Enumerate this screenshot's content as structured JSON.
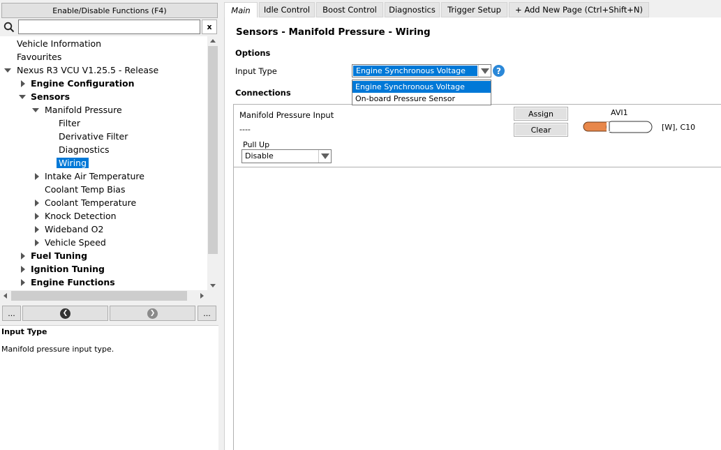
{
  "left_panel": {
    "enable_button_label": "Enable/Disable Functions (F4)",
    "search": {
      "value": "",
      "placeholder": ""
    },
    "clear_search_label": "x",
    "tree": [
      {
        "label": "Vehicle Information"
      },
      {
        "label": "Favourites"
      },
      {
        "label": "Nexus R3 VCU V1.25.5 - Release"
      },
      {
        "label": "Engine Configuration"
      },
      {
        "label": "Sensors"
      },
      {
        "label": "Manifold Pressure"
      },
      {
        "label": "Filter"
      },
      {
        "label": "Derivative Filter"
      },
      {
        "label": "Diagnostics"
      },
      {
        "label": "Wiring"
      },
      {
        "label": "Intake Air Temperature"
      },
      {
        "label": "Coolant Temp Bias"
      },
      {
        "label": "Coolant Temperature"
      },
      {
        "label": "Knock Detection"
      },
      {
        "label": "Wideband O2"
      },
      {
        "label": "Vehicle Speed"
      },
      {
        "label": "Fuel Tuning"
      },
      {
        "label": "Ignition Tuning"
      },
      {
        "label": "Engine Functions"
      }
    ],
    "nav": {
      "more_left": "...",
      "more_right": "..."
    },
    "help": {
      "title": "Input Type",
      "description": "Manifold pressure input type."
    }
  },
  "tabs": [
    {
      "label": "Main"
    },
    {
      "label": "Idle Control"
    },
    {
      "label": "Boost Control"
    },
    {
      "label": "Diagnostics"
    },
    {
      "label": "Trigger Setup"
    },
    {
      "label": "+ Add New Page (Ctrl+Shift+N)"
    }
  ],
  "main": {
    "title": "Sensors - Manifold Pressure - Wiring",
    "options_heading": "Options",
    "input_type": {
      "label": "Input Type",
      "selected": "Engine Synchronous Voltage",
      "options": [
        "Engine Synchronous Voltage",
        "On-board Pressure Sensor"
      ]
    },
    "connections_heading": "Connections",
    "connection": {
      "label": "Manifold Pressure Input",
      "value": "----",
      "assign_label": "Assign",
      "clear_label": "Clear",
      "pin_name": "AVI1",
      "pin_ref": "[W], C10",
      "wire_color": "#e8874a"
    },
    "pull_up": {
      "label": "Pull Up",
      "selected": "Disable"
    }
  },
  "colors": {
    "selection": "#0078d7",
    "help_icon": "#2b88d8"
  }
}
